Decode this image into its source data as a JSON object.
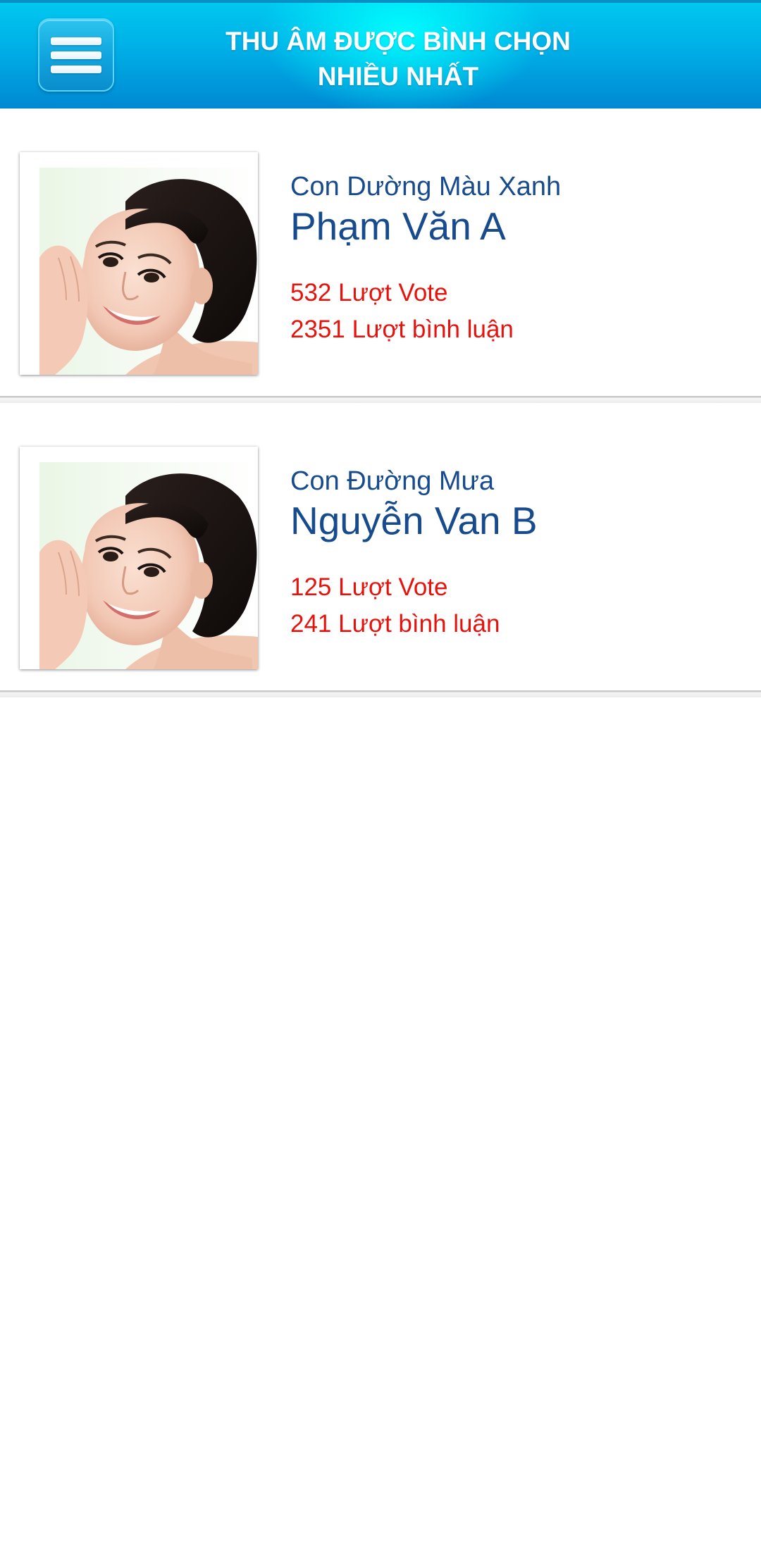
{
  "header": {
    "title_line1": "THU ÂM ĐƯỢC BÌNH CHỌN",
    "title_line2": "NHIỀU NHẤT",
    "menu_icon": "hamburger-menu-icon",
    "colors": {
      "top": "#00c8f0",
      "bottom": "#0088d2"
    }
  },
  "list": {
    "items": [
      {
        "song": "Con Dường Màu Xanh",
        "artist": "Phạm Văn A",
        "votes": "532 Lượt Vote",
        "comments": "2351 Lượt bình luận"
      },
      {
        "song": "Con Đường Mưa",
        "artist": "Nguyễn Van B",
        "votes": "125 Lượt Vote",
        "comments": "241 Lượt bình luận"
      }
    ]
  },
  "colors": {
    "title_blue": "#174b8e",
    "stats_red": "#e8120c"
  }
}
